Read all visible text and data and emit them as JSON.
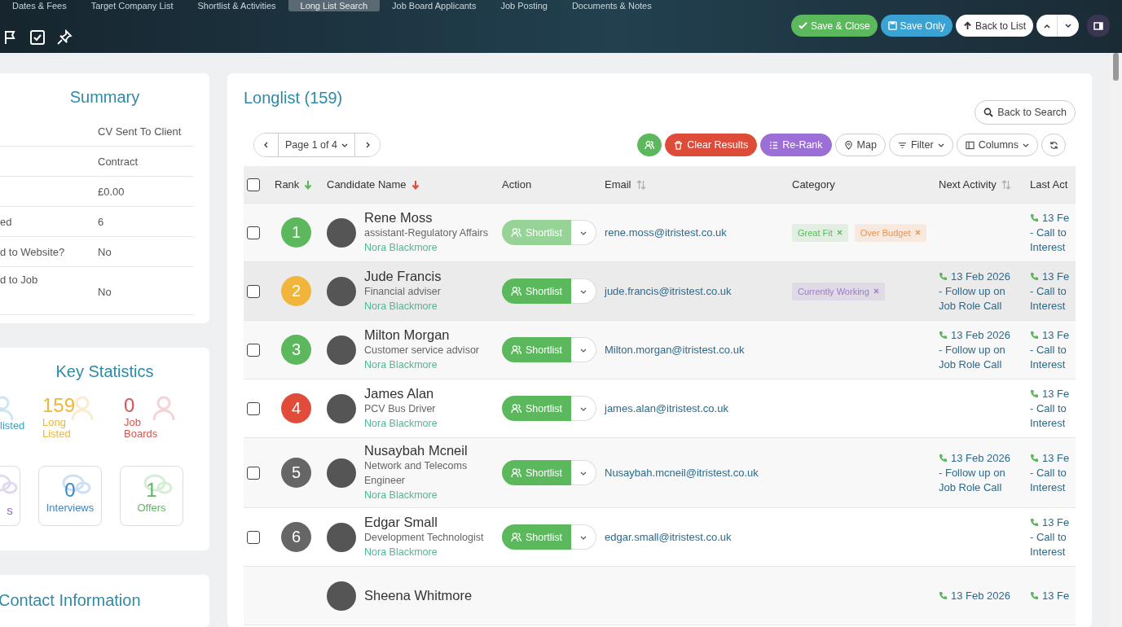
{
  "header": {
    "tabs": [
      {
        "label": "Dates & Fees",
        "selected": false
      },
      {
        "label": "Target Company List",
        "selected": false
      },
      {
        "label": "Shortlist & Activities",
        "selected": false
      },
      {
        "label": "Long List Search",
        "selected": true
      },
      {
        "label": "Job Board Applicants",
        "selected": false
      },
      {
        "label": "Job Posting",
        "selected": false
      },
      {
        "label": "Documents & Notes",
        "selected": false
      }
    ],
    "buttons": [
      {
        "kind": "save-close",
        "label": "Save & Close"
      },
      {
        "kind": "save-only",
        "label": "Save Only"
      },
      {
        "kind": "back",
        "label": "Back to List"
      }
    ]
  },
  "summary": {
    "title": "Summary",
    "rows": [
      {
        "value": "CV Sent To Client"
      },
      {
        "value": "Contract"
      },
      {
        "value": "£0.00"
      },
      {
        "label": "ed",
        "value": "6"
      },
      {
        "label": "d to Website?",
        "value": "No"
      },
      {
        "label": "d to Job",
        "value": "No"
      }
    ]
  },
  "key_statistics": {
    "title": "Key Statistics",
    "top": [
      {
        "kind": "shortlisted",
        "label": "listed",
        "color": "#3aa0c8"
      },
      {
        "kind": "longlisted",
        "count": "159",
        "label": "Long Listed",
        "color": "#f0b53a"
      },
      {
        "kind": "jobboards",
        "count": "0",
        "label": "Job Boards",
        "color": "#d9534f"
      }
    ],
    "cards": [
      {
        "kind": "mail",
        "label": "s",
        "color": "#8e6bc8"
      },
      {
        "kind": "interviews",
        "count": "0",
        "label": "Interviews",
        "color": "#3a86c8"
      },
      {
        "kind": "offers",
        "count": "1",
        "label": "Offers",
        "color": "#5cb85c"
      }
    ]
  },
  "contact": {
    "title": "Contact Information"
  },
  "longlist": {
    "title": "Longlist (159)",
    "back_to_search": "Back to Search",
    "page": "Page 1 of 4",
    "toolbar": [
      {
        "kind": "clear",
        "label": "Clear Results"
      },
      {
        "kind": "rerank",
        "label": "Re-Rank"
      },
      {
        "kind": "map",
        "label": "Map"
      },
      {
        "kind": "filter",
        "label": "Filter"
      },
      {
        "kind": "columns",
        "label": "Columns"
      }
    ],
    "select_all_checked": false,
    "columns": [
      {
        "label": "Rank",
        "kind": "sorted-asc"
      },
      {
        "label": "Candidate Name",
        "kind": "sorted-desc"
      },
      {
        "label": "Action",
        "kind": "plain"
      },
      {
        "label": "Email",
        "kind": "sortable"
      },
      {
        "label": "Category",
        "kind": "plain"
      },
      {
        "label": "Next Activity",
        "kind": "sortable"
      },
      {
        "label": "Last Act",
        "kind": "plain"
      }
    ],
    "rows": [
      {
        "checked": false,
        "rank": "1",
        "color": "#5cb85c",
        "name": "Rene Moss",
        "title": "assistant-Regulatory Affairs",
        "owner": "Nora Blackmore",
        "action": "Shortlist",
        "disabled": true,
        "hovered": false,
        "email": "rene.moss@itristest.co.uk",
        "tags": [
          {
            "label": "Great Fit",
            "color": "#5cb85c"
          },
          {
            "label": "Over Budget",
            "color": "#f0914a"
          }
        ],
        "last": [
          "13 Fe",
          "- Call to",
          "Interest"
        ]
      },
      {
        "checked": false,
        "rank": "2",
        "color": "#f0b53a",
        "name": "Jude Francis",
        "title": "Financial adviser",
        "owner": "Nora Blackmore",
        "action": "Shortlist",
        "disabled": false,
        "hovered": true,
        "email": "jude.francis@itristest.co.uk",
        "tags": [
          {
            "label": "Currently Working",
            "color": "#9b7bc8"
          }
        ],
        "next": {
          "date": "13 Feb 2026",
          "text": "- Follow up on Job Role Call"
        },
        "last": [
          "13 Fe",
          "- Call to",
          "Interest"
        ]
      },
      {
        "checked": false,
        "rank": "3",
        "color": "#5cb85c",
        "name": "Milton Morgan",
        "title": "Customer service advisor",
        "owner": "Nora Blackmore",
        "action": "Shortlist",
        "disabled": false,
        "hovered": false,
        "email": "Milton.morgan@itristest.co.uk",
        "tags": [],
        "next": {
          "date": "13 Feb 2026",
          "text": "- Follow up on Job Role Call"
        },
        "last": [
          "13 Fe",
          "- Call to",
          "Interest"
        ]
      },
      {
        "checked": false,
        "rank": "4",
        "color": "#e04b3a",
        "name": "James Alan",
        "title": "PCV Bus Driver",
        "owner": "Nora Blackmore",
        "action": "Shortlist",
        "disabled": false,
        "hovered": false,
        "email": "james.alan@itristest.co.uk",
        "tags": [],
        "last": [
          "13 Fe",
          "- Call to",
          "Interest"
        ]
      },
      {
        "checked": false,
        "rank": "5",
        "color": "#666666",
        "name": "Nusaybah Mcneil",
        "title": "Network and Telecoms Engineer",
        "owner": "Nora Blackmore",
        "action": "Shortlist",
        "disabled": false,
        "hovered": false,
        "email": "Nusaybah.mcneil@itristest.co.uk",
        "tags": [],
        "next": {
          "date": "13 Feb 2026",
          "text": "- Follow up on Job Role Call"
        },
        "last": [
          "13 Fe",
          "- Call to",
          "Interest"
        ]
      },
      {
        "checked": false,
        "rank": "6",
        "color": "#666666",
        "name": "Edgar Small",
        "title": "Development Technologist",
        "owner": "Nora Blackmore",
        "action": "Shortlist",
        "disabled": false,
        "hovered": false,
        "email": "edgar.small@itristest.co.uk",
        "tags": [],
        "last": [
          "13 Fe",
          "- Call to",
          "Interest"
        ]
      },
      {
        "name": "Sheena Whitmore",
        "tags": [],
        "next": {
          "date": "13 Feb 2026"
        },
        "last": [
          "13 Fe"
        ]
      }
    ]
  }
}
